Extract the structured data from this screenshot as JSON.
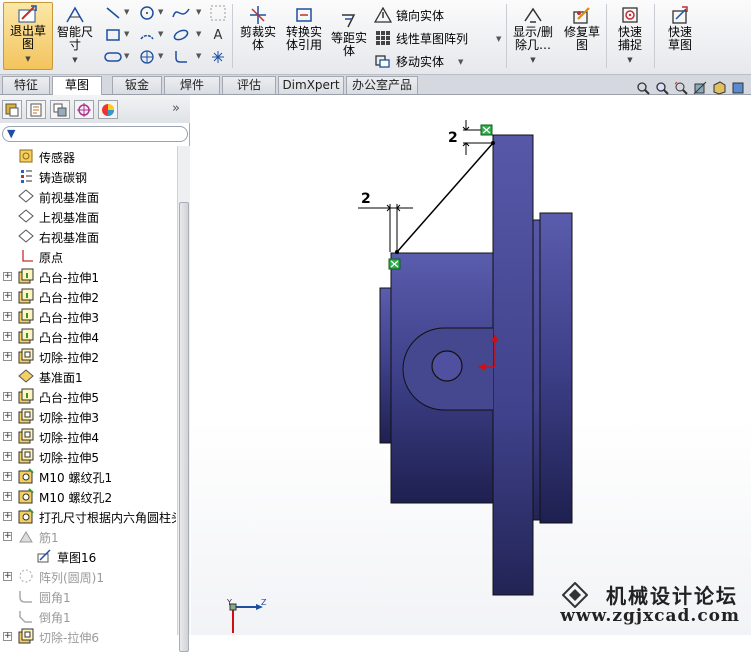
{
  "ribbon": {
    "exit_sketch": "退出草图",
    "smart_dimension": "智能尺寸",
    "trim": "剪裁实体",
    "convert": "转换实体引用",
    "offset": "等距实体",
    "mirror": "镜向实体",
    "linear_pattern": "线性草图阵列",
    "move": "移动实体",
    "display_delete": "显示/删除几…",
    "repair": "修复草图",
    "quick_snaps": "快速捕捉",
    "rapid_sketch": "快速草图"
  },
  "tabs": [
    {
      "label": "特征",
      "active": false
    },
    {
      "label": "草图",
      "active": true
    },
    {
      "label": "钣金",
      "active": false
    },
    {
      "label": "焊件",
      "active": false
    },
    {
      "label": "评估",
      "active": false
    },
    {
      "label": "DimXpert",
      "active": false
    },
    {
      "label": "办公室产品",
      "active": false
    }
  ],
  "tree": [
    {
      "label": "传感器",
      "icon": "sensor-icon",
      "expand": false,
      "grey": false
    },
    {
      "label": "铸造碳钢",
      "icon": "material-icon",
      "expand": false,
      "grey": false
    },
    {
      "label": "前视基准面",
      "icon": "plane-icon",
      "expand": false,
      "grey": false
    },
    {
      "label": "上视基准面",
      "icon": "plane-icon",
      "expand": false,
      "grey": false
    },
    {
      "label": "右视基准面",
      "icon": "plane-icon",
      "expand": false,
      "grey": false
    },
    {
      "label": "原点",
      "icon": "origin-icon",
      "expand": false,
      "grey": false
    },
    {
      "label": "凸台-拉伸1",
      "icon": "boss-extrude-icon",
      "expand": true,
      "grey": false
    },
    {
      "label": "凸台-拉伸2",
      "icon": "boss-extrude-icon",
      "expand": true,
      "grey": false
    },
    {
      "label": "凸台-拉伸3",
      "icon": "boss-extrude-icon",
      "expand": true,
      "grey": false
    },
    {
      "label": "凸台-拉伸4",
      "icon": "boss-extrude-icon",
      "expand": true,
      "grey": false
    },
    {
      "label": "切除-拉伸2",
      "icon": "cut-extrude-icon",
      "expand": true,
      "grey": false
    },
    {
      "label": "基准面1",
      "icon": "plane1-icon",
      "expand": false,
      "grey": false
    },
    {
      "label": "凸台-拉伸5",
      "icon": "boss-extrude-icon",
      "expand": true,
      "grey": false
    },
    {
      "label": "切除-拉伸3",
      "icon": "cut-extrude-icon",
      "expand": true,
      "grey": false
    },
    {
      "label": "切除-拉伸4",
      "icon": "cut-extrude-icon",
      "expand": true,
      "grey": false
    },
    {
      "label": "切除-拉伸5",
      "icon": "cut-extrude-icon",
      "expand": true,
      "grey": false
    },
    {
      "label": "M10 螺纹孔1",
      "icon": "hole-icon",
      "expand": true,
      "grey": false
    },
    {
      "label": "M10 螺纹孔2",
      "icon": "hole-icon",
      "expand": true,
      "grey": false
    },
    {
      "label": "打孔尺寸根据内六角圆柱头",
      "icon": "hole-icon",
      "expand": true,
      "grey": false
    },
    {
      "label": "筋1",
      "icon": "rib-icon",
      "expand": true,
      "grey": true
    },
    {
      "label": "草图16",
      "icon": "sketch-icon",
      "expand": false,
      "grey": false,
      "indent": true
    },
    {
      "label": "阵列(圆周)1",
      "icon": "pattern-icon",
      "expand": true,
      "grey": true
    },
    {
      "label": "圆角1",
      "icon": "fillet-icon",
      "expand": false,
      "grey": true
    },
    {
      "label": "倒角1",
      "icon": "chamfer-icon",
      "expand": false,
      "grey": true
    },
    {
      "label": "切除-拉伸6",
      "icon": "cut-extrude-icon",
      "expand": true,
      "grey": true
    }
  ],
  "dimensions": {
    "vertical": "2",
    "horizontal": "2"
  },
  "watermark": {
    "title": "机械设计论坛",
    "url": "www.zgjxcad.com"
  },
  "colors": {
    "part": "#4a4c9a",
    "part_dark": "#2e3070",
    "accent": "#f3c45d"
  }
}
